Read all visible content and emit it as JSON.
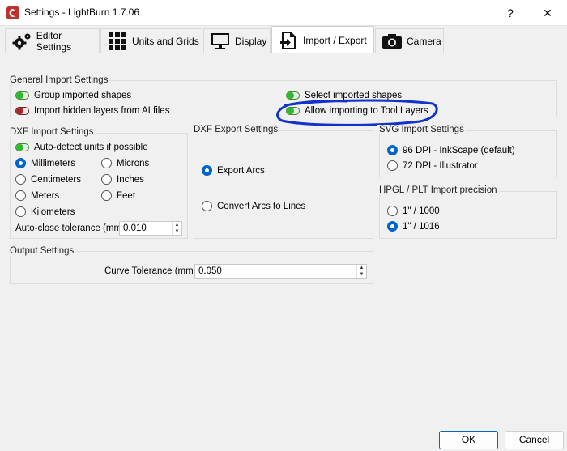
{
  "window": {
    "title": "Settings - LightBurn 1.7.06",
    "help_label": "?",
    "close_label": "✕"
  },
  "tabs": [
    {
      "label": "Editor Settings",
      "icon": "gears-icon"
    },
    {
      "label": "Units and Grids",
      "icon": "grid-icon"
    },
    {
      "label": "Display",
      "icon": "monitor-icon"
    },
    {
      "label": "Import / Export",
      "icon": "import-export-icon",
      "active": true
    },
    {
      "label": "Camera",
      "icon": "camera-icon"
    }
  ],
  "general": {
    "title": "General Import Settings",
    "group_imported_shapes": {
      "label": "Group imported shapes",
      "on": true
    },
    "import_hidden_layers": {
      "label": "Import hidden layers from AI files",
      "on": false
    },
    "select_imported_shapes": {
      "label": "Select imported shapes",
      "on": true
    },
    "allow_tool_layers": {
      "label": "Allow importing to Tool Layers",
      "on": true
    }
  },
  "dxf_import": {
    "title": "DXF Import Settings",
    "auto_detect": {
      "label": "Auto-detect units if possible",
      "on": true
    },
    "units": {
      "millimeters": "Millimeters",
      "centimeters": "Centimeters",
      "meters": "Meters",
      "kilometers": "Kilometers",
      "microns": "Microns",
      "inches": "Inches",
      "feet": "Feet",
      "selected": "Millimeters"
    },
    "auto_close_label": "Auto-close tolerance (mm)",
    "auto_close_value": "0.010"
  },
  "dxf_export": {
    "title": "DXF Export Settings",
    "export_arcs": "Export Arcs",
    "convert_arcs": "Convert Arcs to Lines",
    "selected": "Export Arcs"
  },
  "svg_import": {
    "title": "SVG Import Settings",
    "dpi_96": "96 DPI - InkScape (default)",
    "dpi_72": "72 DPI - Illustrator",
    "selected": "96 DPI - InkScape (default)"
  },
  "hpgl": {
    "title": "HPGL / PLT Import precision",
    "p1000": "1\" / 1000",
    "p1016": "1\" / 1016",
    "selected": "1\" / 1016"
  },
  "output": {
    "title": "Output Settings",
    "curve_tolerance_label": "Curve Tolerance (mm)",
    "curve_tolerance_value": "0.050"
  },
  "buttons": {
    "ok": "OK",
    "cancel": "Cancel"
  },
  "colors": {
    "accent": "#0067c0",
    "toggle_on": "#2dbb2d",
    "toggle_off": "#a52a2a",
    "annotation": "#1133cc"
  }
}
